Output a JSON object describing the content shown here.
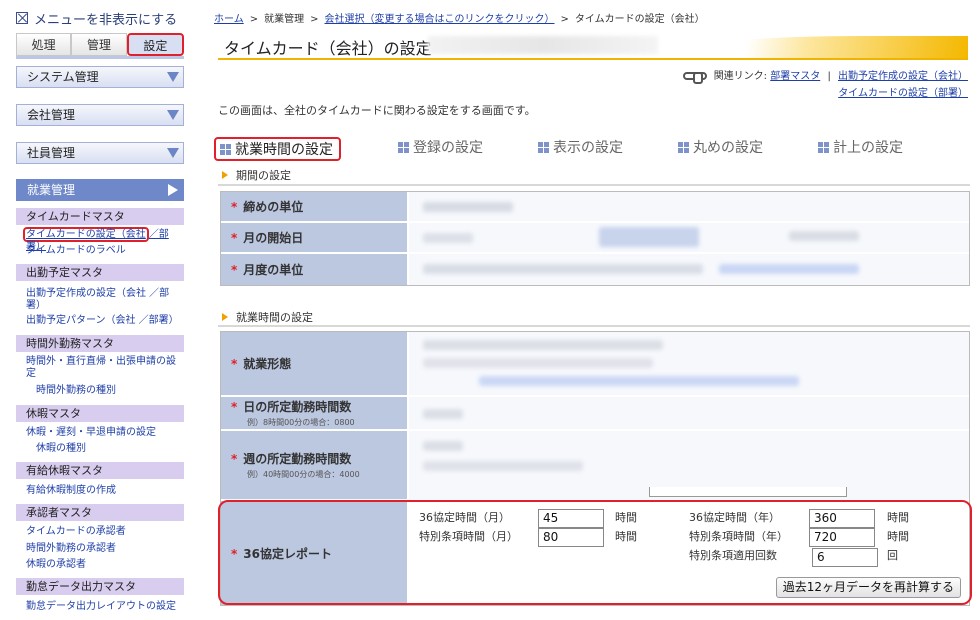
{
  "sidebar": {
    "hide_menu": "メニューを非表示にする",
    "tabs": [
      "処理",
      "管理",
      "設定"
    ],
    "categories": {
      "system": "システム管理",
      "company": "会社管理",
      "staff": "社員管理",
      "work": "就業管理"
    },
    "sections": {
      "timecard_master": "タイムカードマスタ",
      "timecard_setting_a": "タイムカードの設定（会社",
      "timecard_setting_b": "／部署）",
      "timecard_label": "タイムカードのラベル",
      "schedule_master": "出勤予定マスタ",
      "schedule_create": "出勤予定作成の設定（会社 ／部署）",
      "schedule_pattern": "出勤予定パターン（会社 ／部署）",
      "overtime_master": "時間外勤務マスタ",
      "overtime_apply": "時間外・直行直帰・出張申請の設定",
      "overtime_types": "時間外勤務の種別",
      "leave_master": "休暇マスタ",
      "leave_apply": "休暇・遅刻・早退申請の設定",
      "leave_types": "休暇の種別",
      "paid_master": "有給休暇マスタ",
      "paid_create": "有給休暇制度の作成",
      "approver_master": "承認者マスタ",
      "approver_timecard": "タイムカードの承認者",
      "approver_overtime": "時間外勤務の承認者",
      "approver_leave": "休暇の承認者",
      "export_master": "勤怠データ出力マスタ",
      "export_layout": "勤怠データ出力レイアウトの設定"
    }
  },
  "breadcrumb": {
    "home": "ホーム",
    "work": "就業管理",
    "company_select": "会社選択（変更する場合はこのリンクをクリック）",
    "current": "タイムカードの設定（会社）"
  },
  "page": {
    "title": "タイムカード（会社）の設定",
    "related_label": "関連リンク:",
    "related_links": [
      "部署マスタ",
      "出勤予定作成の設定（会社）",
      "タイムカードの設定（部署）"
    ],
    "related_sep": "|",
    "description": "この画面は、全社のタイムカードに関わる設定をする画面です。"
  },
  "section_tabs": [
    "就業時間の設定",
    "登録の設定",
    "表示の設定",
    "丸めの設定",
    "計上の設定"
  ],
  "period": {
    "heading": "期間の設定",
    "rows": [
      "締めの単位",
      "月の開始日",
      "月度の単位"
    ]
  },
  "worktime": {
    "heading": "就業時間の設定",
    "rows": [
      {
        "label": "就業形態",
        "sub": ""
      },
      {
        "label": "日の所定勤務時間数",
        "sub": "例）8時間00分の場合：0800"
      },
      {
        "label": "週の所定勤務時間数",
        "sub": "例）40時間00分の場合：4000"
      }
    ]
  },
  "report36": {
    "label": "36協定レポート",
    "month_hours_label": "36協定時間（月）",
    "month_hours_value": "45",
    "special_month_label": "特別条項時間（月）",
    "special_month_value": "80",
    "year_hours_label": "36協定時間（年）",
    "year_hours_value": "360",
    "special_year_label": "特別条項時間（年）",
    "special_year_value": "720",
    "special_count_label": "特別条項適用回数",
    "special_count_value": "6",
    "unit_hours": "時間",
    "unit_times": "回",
    "recalc_button": "過去12ヶ月データを再計算する"
  },
  "colors": {
    "accent_red": "#e0202a",
    "label_bg": "#bcc7e0",
    "menu_blue": "#6f88c9",
    "sub_purple": "#d8cdef",
    "title_gold": "#f0b400"
  }
}
